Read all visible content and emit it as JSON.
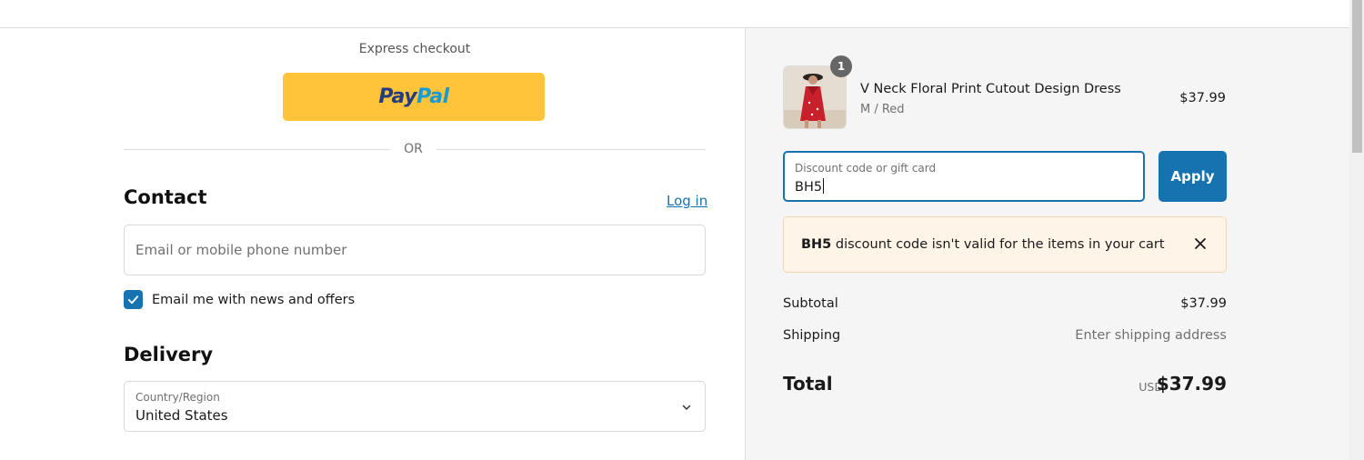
{
  "express": {
    "label": "Express checkout",
    "paypal_pay": "Pay",
    "paypal_pal": "Pal",
    "or_text": "OR"
  },
  "contact": {
    "heading": "Contact",
    "login_link": "Log in",
    "email_placeholder": "Email or mobile phone number",
    "email_value": "",
    "newsletter_label": "Email me with news and offers",
    "newsletter_checked": true
  },
  "delivery": {
    "heading": "Delivery",
    "country_label": "Country/Region",
    "country_value": "United States"
  },
  "cart": {
    "item": {
      "title": "V Neck Floral Print Cutout Design Dress",
      "variant": "M / Red",
      "price": "$37.99",
      "quantity": "1"
    },
    "discount": {
      "label": "Discount code or gift card",
      "value": "BH5",
      "apply_label": "Apply",
      "error_code": "BH5",
      "error_text": " discount code isn't valid for the items in your cart"
    },
    "summary": {
      "subtotal_label": "Subtotal",
      "subtotal_value": "$37.99",
      "shipping_label": "Shipping",
      "shipping_value": "Enter shipping address",
      "total_label": "Total",
      "total_currency": "USD",
      "total_value": "$37.99"
    }
  },
  "colors": {
    "accent": "#1773b0",
    "paypal_yellow": "#ffc439",
    "error_bg": "#fff4e8"
  },
  "icons": [
    "paypal-logo",
    "checkmark-icon",
    "chevron-down-icon",
    "close-icon"
  ]
}
